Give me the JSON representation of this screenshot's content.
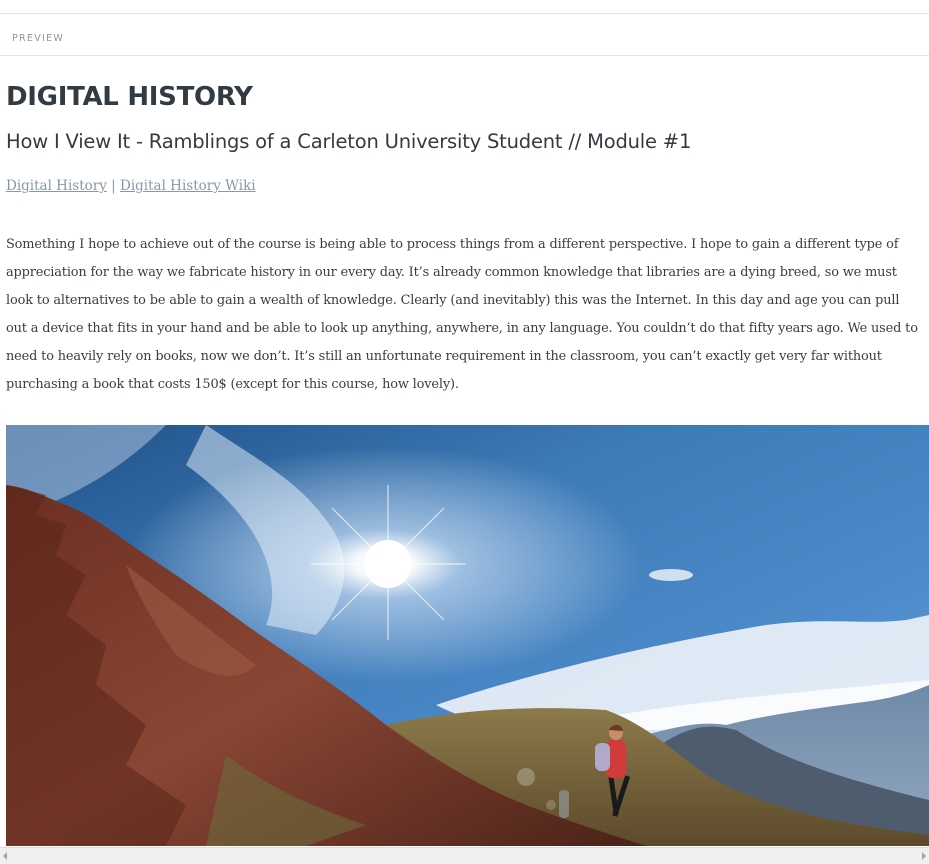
{
  "preview_label": "PREVIEW",
  "post": {
    "title": "DIGITAL HISTORY",
    "subtitle": "How I View It - Ramblings of a Carleton University Student // Module #1",
    "links": [
      {
        "label": "Digital History"
      },
      {
        "label": "Digital History Wiki"
      }
    ],
    "link_separator": "|",
    "body": "Something I hope to achieve out of the course is being able to process things from a different perspective. I hope to gain a different type of appreciation for the way we fabricate history in our every day. It’s already common knowledge that libraries are a dying breed, so we must look to alternatives to be able to gain a wealth of knowledge. Clearly (and inevitably) this was the Internet. In this day and age you can pull out a device that fits in your hand and be able to look up anything, anywhere, in any language. You couldn’t do that fifty years ago. We used to need to heavily rely on books, now we don’t. It’s still an unfortunate requirement in the classroom, you can’t exactly get very far without purchasing a book that costs 150$ (except for this course, how lovely)."
  },
  "colors": {
    "heading": "#333b42",
    "link": "#8a97a8",
    "body_text": "#3a3d40",
    "sky": "#2f6aa8"
  },
  "icons": {
    "scroll_left": "triangle-left",
    "scroll_right": "triangle-right"
  }
}
